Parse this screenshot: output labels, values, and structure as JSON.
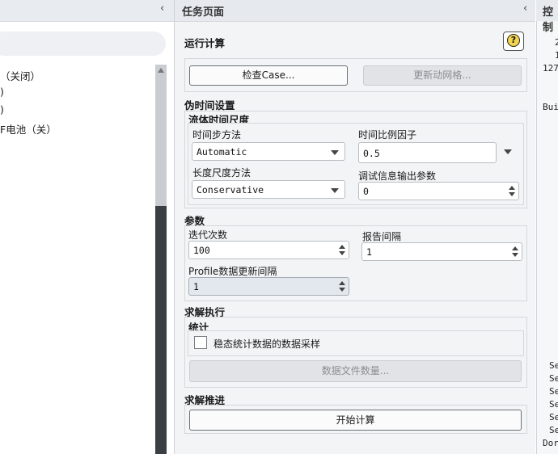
{
  "left_panel": {
    "tree_items": [
      "（关闭）",
      ")",
      ")",
      "F电池（关）"
    ]
  },
  "task_panel": {
    "title": "任务页面",
    "heading": "运行计算",
    "help_icon": "?",
    "check_case_button": "检查Case...",
    "update_mesh_button": "更新动网格...",
    "pseudo_time": {
      "title": "伪时间设置",
      "fluid_time_scale": "流体时间尺度",
      "time_step_method_label": "时间步方法",
      "time_step_method_value": "Automatic",
      "time_scale_factor_label": "时间比例因子",
      "time_scale_factor_value": "0.5",
      "length_scale_method_label": "长度尺度方法",
      "length_scale_method_value": "Conservative",
      "debug_output_label": "调试信息输出参数",
      "debug_output_value": "0"
    },
    "parameters": {
      "title": "参数",
      "iterations_label": "迭代次数",
      "iterations_value": "100",
      "report_interval_label": "报告间隔",
      "report_interval_value": "1",
      "profile_update_label": "Profile数据更新间隔",
      "profile_update_value": "1"
    },
    "solution": {
      "title": "求解执行",
      "statistics": "统计",
      "steady_sampling_label": "稳态统计数据的数据采样",
      "data_file_count_button": "数据文件数量..."
    },
    "advance": {
      "title": "求解推进",
      "start_button": "开始计算"
    }
  },
  "console": {
    "title": "控制",
    "lines": [
      "2",
      "1",
      "127",
      "Bui",
      "Se",
      "Se",
      "Se",
      "Se",
      "Se",
      "Se",
      "Dor"
    ]
  }
}
